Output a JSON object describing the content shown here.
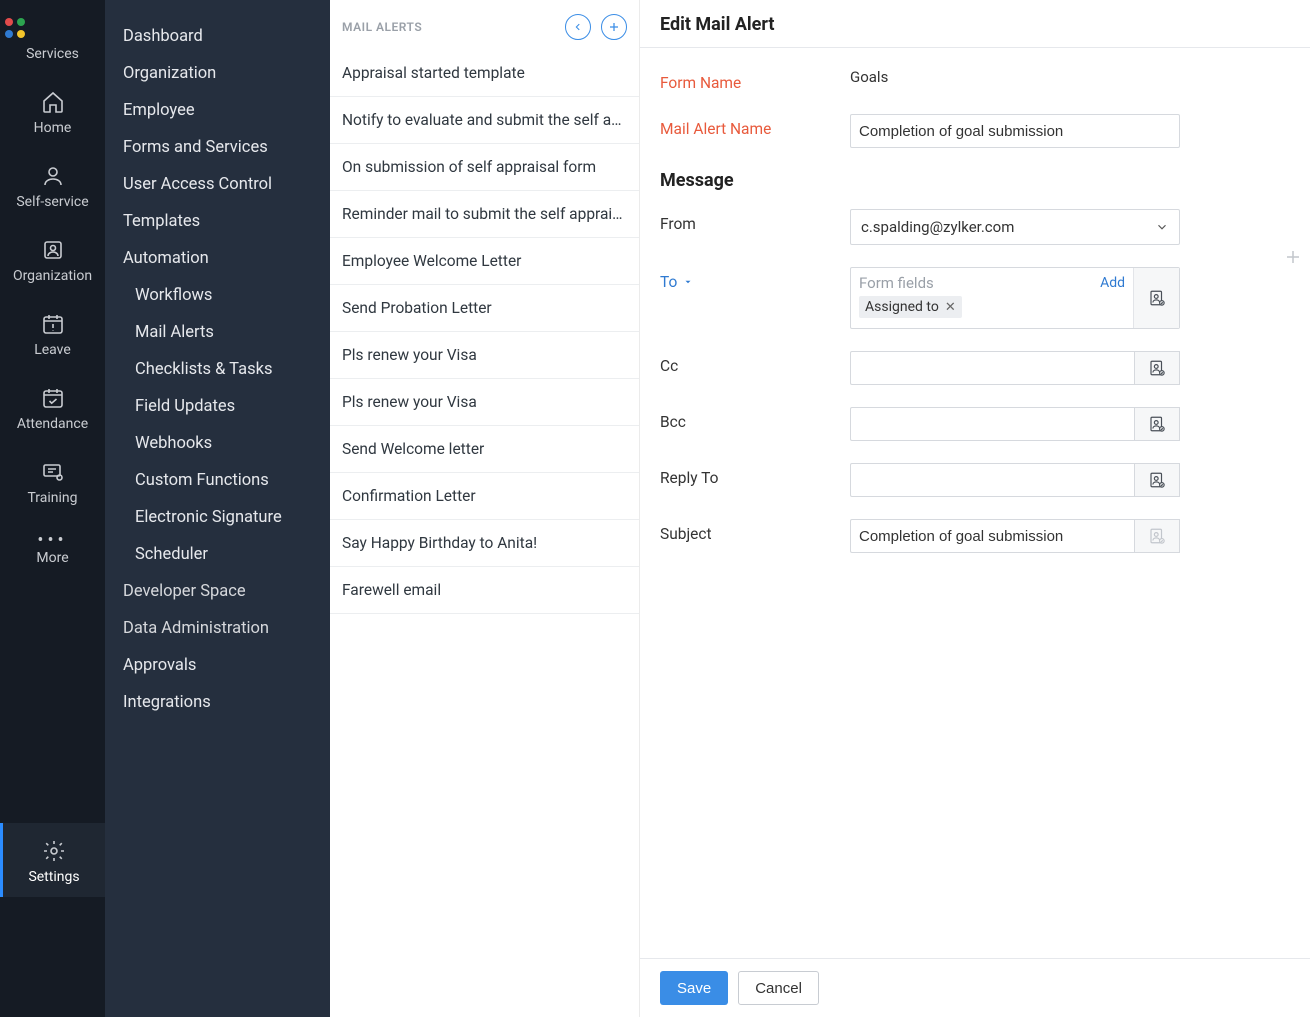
{
  "rail": {
    "items": [
      {
        "label": "Services"
      },
      {
        "label": "Home"
      },
      {
        "label": "Self-service"
      },
      {
        "label": "Organization"
      },
      {
        "label": "Leave"
      },
      {
        "label": "Attendance"
      },
      {
        "label": "Training"
      },
      {
        "label": "More"
      },
      {
        "label": "Settings"
      }
    ]
  },
  "sidebar": {
    "items": [
      {
        "label": "Dashboard"
      },
      {
        "label": "Organization"
      },
      {
        "label": "Employee"
      },
      {
        "label": "Forms and Services"
      },
      {
        "label": "User Access Control"
      },
      {
        "label": "Templates"
      },
      {
        "label": "Automation"
      }
    ],
    "automation_children": [
      {
        "label": "Workflows"
      },
      {
        "label": "Mail Alerts"
      },
      {
        "label": "Checklists & Tasks"
      },
      {
        "label": "Field Updates"
      },
      {
        "label": "Webhooks"
      },
      {
        "label": "Custom Functions"
      },
      {
        "label": "Electronic Signature"
      },
      {
        "label": "Scheduler"
      }
    ],
    "items2": [
      {
        "label": "Developer Space"
      },
      {
        "label": "Data Administration"
      },
      {
        "label": "Approvals"
      },
      {
        "label": "Integrations"
      }
    ]
  },
  "listcol": {
    "title": "MAIL ALERTS",
    "items": [
      "Appraisal started template",
      "Notify to evaluate and submit the self a…",
      "On submission of self appraisal form",
      "Reminder mail to submit the self apprai…",
      "Employee Welcome Letter",
      "Send Probation Letter",
      "Pls renew your Visa",
      "Pls renew your Visa",
      "Send Welcome letter",
      "Confirmation Letter",
      "Say Happy Birthday to Anita!",
      "Farewell email"
    ]
  },
  "editor": {
    "title": "Edit Mail Alert",
    "form_name_label": "Form Name",
    "form_name_value": "Goals",
    "mail_alert_name_label": "Mail Alert Name",
    "mail_alert_name_value": "Completion of goal submission",
    "message_label": "Message",
    "from_label": "From",
    "from_value": "c.spalding@zylker.com",
    "to_label": "To",
    "to_placeholder": "Form fields",
    "to_add_link": "Add",
    "to_tag": "Assigned to",
    "cc_label": "Cc",
    "bcc_label": "Bcc",
    "reply_to_label": "Reply To",
    "subject_label": "Subject",
    "subject_value": "Completion of goal submission",
    "save_label": "Save",
    "cancel_label": "Cancel"
  }
}
